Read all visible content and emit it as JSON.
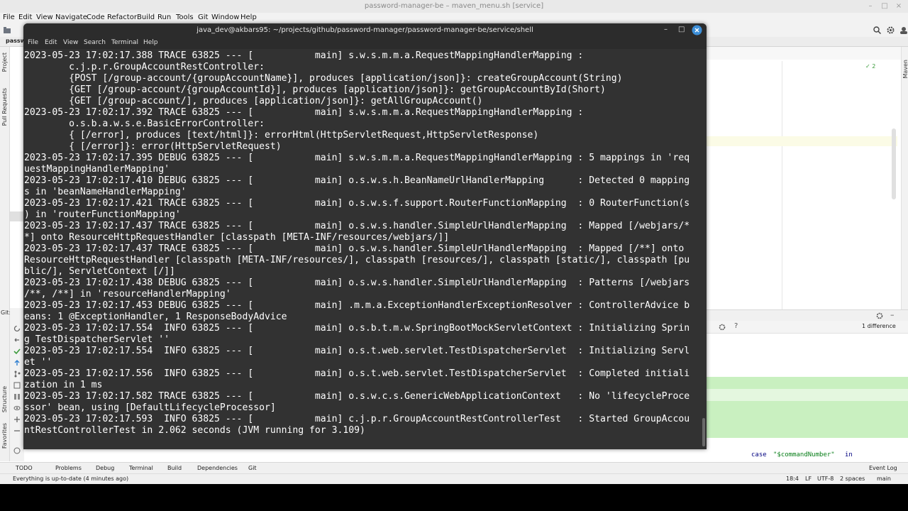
{
  "ide": {
    "title": "password-manager-be – maven_menu.sh [service]",
    "window_controls": [
      "–",
      "□",
      "×"
    ],
    "menu": [
      "File",
      "Edit",
      "View",
      "Navigate",
      "Code",
      "Refactor",
      "Build",
      "Run",
      "Tools",
      "Git",
      "Window",
      "Help"
    ],
    "project_tab": "passw",
    "left_tools": [
      "Project",
      "Pull Requests",
      "Structure",
      "Favorites"
    ],
    "git_label": "Git:",
    "maven_label": "Maven",
    "inspection_badge": "✓ 2",
    "diff_label": "1 difference",
    "code_line": {
      "keyword": "case",
      "string": "\"$commandNumber\"",
      "in": "in"
    },
    "tool_windows": [
      "TODO",
      "Problems",
      "Debug",
      "Terminal",
      "Build",
      "Dependencies",
      "Git"
    ],
    "event_log": "Event Log",
    "status": {
      "message": "Everything is up-to-date (4 minutes ago)",
      "position": "18:4",
      "line_sep": "LF",
      "encoding": "UTF-8",
      "indent": "2 spaces",
      "branch": "main"
    }
  },
  "terminal": {
    "title": "java_dev@akbars95: ~/projects/github/password-manager/password-manager-be/service/shell",
    "menu": [
      "File",
      "Edit",
      "View",
      "Search",
      "Terminal",
      "Help"
    ],
    "lines": [
      "2023-05-23 17:02:17.388 TRACE 63825 --- [           main] s.w.s.m.m.a.RequestMappingHandlerMapping : ",
      "\tc.j.p.r.GroupAccountRestController:",
      "\t{POST [/group-account/{groupAccountName}], produces [application/json]}: createGroupAccount(String)",
      "\t{GET [/group-account/{groupAccountId}], produces [application/json]}: getGroupAccountById(Short)",
      "\t{GET [/group-account/], produces [application/json]}: getAllGroupAccount()",
      "2023-05-23 17:02:17.392 TRACE 63825 --- [           main] s.w.s.m.m.a.RequestMappingHandlerMapping : ",
      "\to.s.b.a.w.s.e.BasicErrorController:",
      "\t{ [/error], produces [text/html]}: errorHtml(HttpServletRequest,HttpServletResponse)",
      "\t{ [/error]}: error(HttpServletRequest)",
      "2023-05-23 17:02:17.395 DEBUG 63825 --- [           main] s.w.s.m.m.a.RequestMappingHandlerMapping : 5 mappings in 'req",
      "uestMappingHandlerMapping'",
      "2023-05-23 17:02:17.410 DEBUG 63825 --- [           main] o.s.w.s.h.BeanNameUrlHandlerMapping      : Detected 0 mapping",
      "s in 'beanNameHandlerMapping'",
      "2023-05-23 17:02:17.421 TRACE 63825 --- [           main] o.s.w.s.f.support.RouterFunctionMapping  : 0 RouterFunction(s",
      ") in 'routerFunctionMapping'",
      "2023-05-23 17:02:17.437 TRACE 63825 --- [           main] o.s.w.s.handler.SimpleUrlHandlerMapping  : Mapped [/webjars/*",
      "*] onto ResourceHttpRequestHandler [classpath [META-INF/resources/webjars/]]",
      "2023-05-23 17:02:17.437 TRACE 63825 --- [           main] o.s.w.s.handler.SimpleUrlHandlerMapping  : Mapped [/**] onto ",
      "ResourceHttpRequestHandler [classpath [META-INF/resources/], classpath [resources/], classpath [static/], classpath [pu",
      "blic/], ServletContext [/]]",
      "2023-05-23 17:02:17.438 DEBUG 63825 --- [           main] o.s.w.s.handler.SimpleUrlHandlerMapping  : Patterns [/webjars",
      "/**, /**] in 'resourceHandlerMapping'",
      "2023-05-23 17:02:17.453 DEBUG 63825 --- [           main] .m.m.a.ExceptionHandlerExceptionResolver : ControllerAdvice b",
      "eans: 1 @ExceptionHandler, 1 ResponseBodyAdvice",
      "2023-05-23 17:02:17.554  INFO 63825 --- [           main] o.s.b.t.m.w.SpringBootMockServletContext : Initializing Sprin",
      "g TestDispatcherServlet ''",
      "2023-05-23 17:02:17.554  INFO 63825 --- [           main] o.s.t.web.servlet.TestDispatcherServlet  : Initializing Servl",
      "et ''",
      "2023-05-23 17:02:17.556  INFO 63825 --- [           main] o.s.t.web.servlet.TestDispatcherServlet  : Completed initiali",
      "zation in 1 ms",
      "2023-05-23 17:02:17.582 TRACE 63825 --- [           main] o.s.w.c.s.GenericWebApplicationContext   : No 'lifecycleProce",
      "ssor' bean, using [DefaultLifecycleProcessor]",
      "2023-05-23 17:02:17.593  INFO 63825 --- [           main] c.j.p.r.GroupAccountRestControllerTest   : Started GroupAccou",
      "ntRestControllerTest in 2.062 seconds (JVM running for 3.109)"
    ]
  }
}
